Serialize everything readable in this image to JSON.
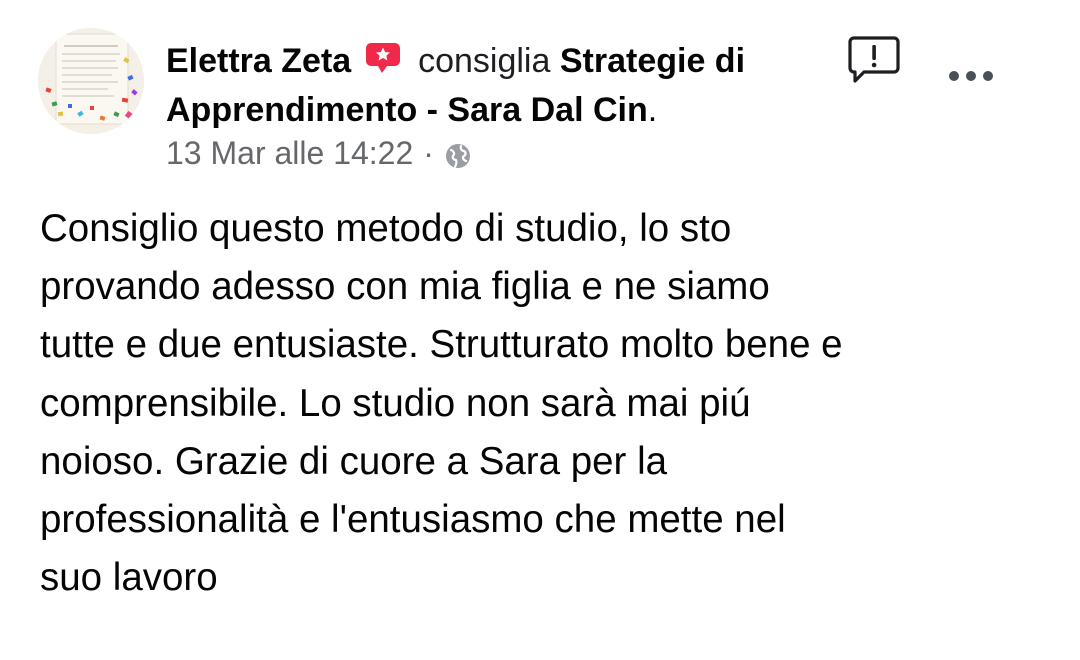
{
  "post": {
    "author": "Elettra Zeta",
    "action": "consiglia",
    "page_name": "Strategie di Apprendimento - Sara Dal Cin",
    "page_suffix": ".",
    "timestamp": "13 Mar alle 14:22",
    "separator": "·",
    "privacy_icon": "globe-icon",
    "recommend_icon": "recommendation-star-icon",
    "text": "Consiglio  questo metodo di studio, lo sto\nprovando adesso con mia figlia e ne siamo\ntutte e due  entusiaste. Strutturato molto bene e\ncomprensibile. Lo studio non sarà mai piú\nnoioso. Grazie di cuore a Sara per la\nprofessionalità e l'entusiasmo che mette nel\nsuo lavoro"
  },
  "actions": {
    "report_icon": "report-icon",
    "more_icon": "more-options-icon"
  },
  "colors": {
    "recommend_badge": "#f02849",
    "meta_text": "#65676b",
    "text": "#050505"
  }
}
